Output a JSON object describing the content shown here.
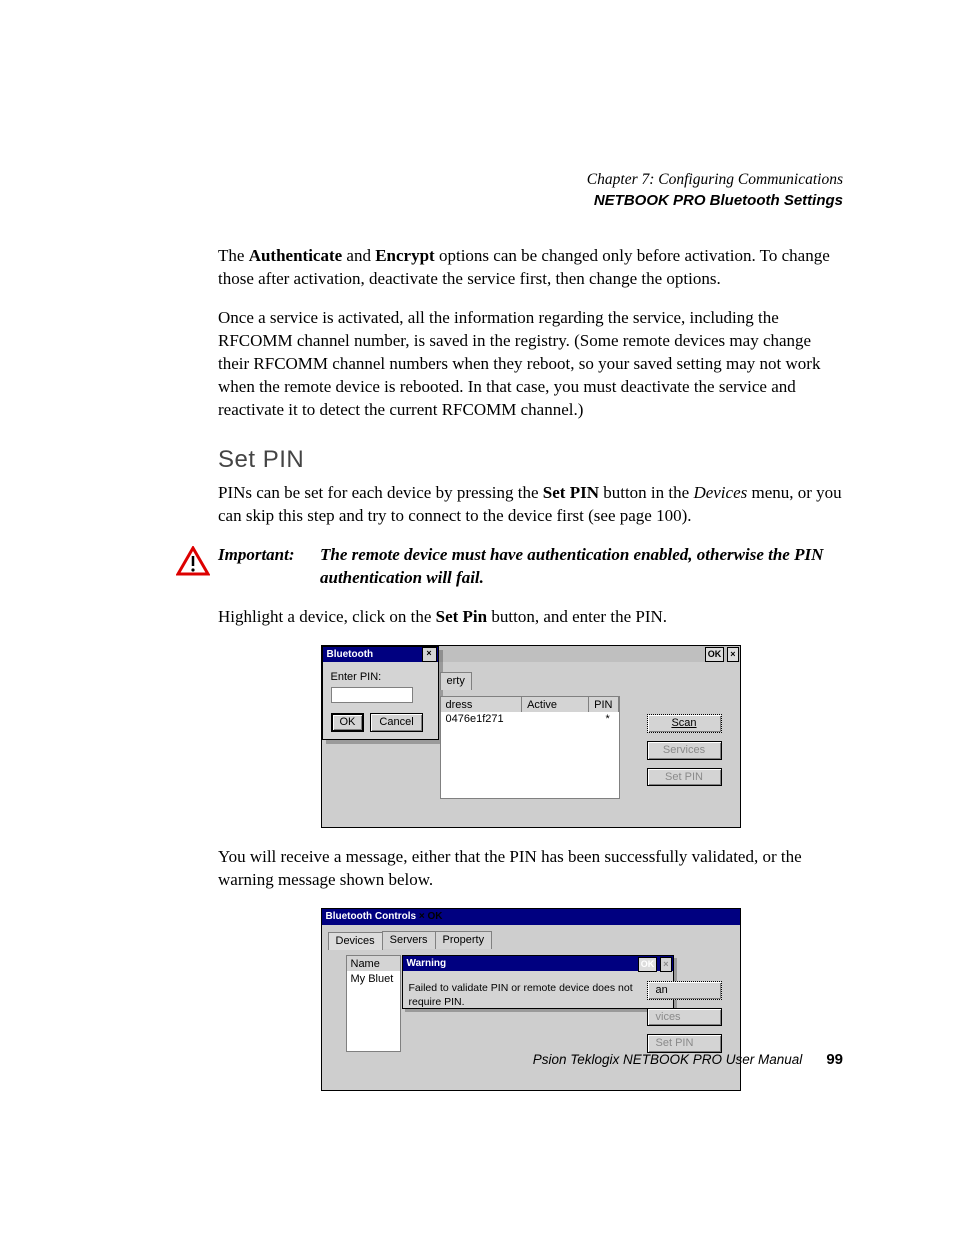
{
  "chapter_line": "Chapter 7:  Configuring Communications",
  "chapter_sub": "NETBOOK PRO Bluetooth Settings",
  "para1_pre": "The ",
  "para1_b1": "Authenticate",
  "para1_mid": " and ",
  "para1_b2": "Encrypt",
  "para1_post": " options can be changed only before activation. To change those after activation, deactivate the service first, then change the options.",
  "para2": "Once a service is activated, all the information regarding the service, including the RFCOMM channel number, is saved in the registry. (Some remote devices may change their RFCOMM channel numbers when they reboot, so your saved setting may not work when the remote device is rebooted. In that case, you must deactivate the service and reactivate it to detect the current RFCOMM channel.)",
  "heading": "Set PIN",
  "para3_pre": "PINs can be set for each device by pressing the ",
  "para3_b": "Set PIN",
  "para3_mid": " button in the ",
  "para3_i": "Devices",
  "para3_post": " menu, or you can skip this step and try to connect to the device first (see page 100).",
  "important_label": "Important:",
  "important_body": "The remote device must have authentication enabled, otherwise the PIN authentication will fail.",
  "para4_pre": "Highlight a device, click on the ",
  "para4_b": "Set Pin",
  "para4_post": " button, and enter the PIN.",
  "para5": "You will receive a message, either that the PIN has been successfully validated, or the warning message shown below.",
  "footer_text": "Psion Teklogix NETBOOK PRO User Manual",
  "footer_page": "99",
  "shot1": {
    "titlebar_ok": "OK",
    "titlebar_x": "×",
    "dialog_title": "Bluetooth",
    "dialog_close": "×",
    "enter_pin_label": "Enter PIN:",
    "ok_btn": "OK",
    "cancel_btn": "Cancel",
    "tab_partial": "erty",
    "col_dress": "dress",
    "col_active": "Active",
    "col_pin": "PIN",
    "row_addr": "0476e1f271",
    "row_pin": "*",
    "btn_scan": "Scan",
    "btn_services": "Services",
    "btn_setpin": "Set PIN"
  },
  "shot2": {
    "title": "Bluetooth Controls",
    "titlebar_ok": "OK",
    "titlebar_x": "×",
    "tab_devices": "Devices",
    "tab_servers": "Servers",
    "tab_property": "Property",
    "col_name": "Name",
    "row_name": "My Bluet",
    "warn_title": "Warning",
    "warn_ok": "OK",
    "warn_x": "×",
    "warn_msg": "Failed to validate PIN or remote device does not require PIN.",
    "btn_scan_partial": "an",
    "btn_services_partial": "vices",
    "btn_setpin": "Set PIN"
  }
}
